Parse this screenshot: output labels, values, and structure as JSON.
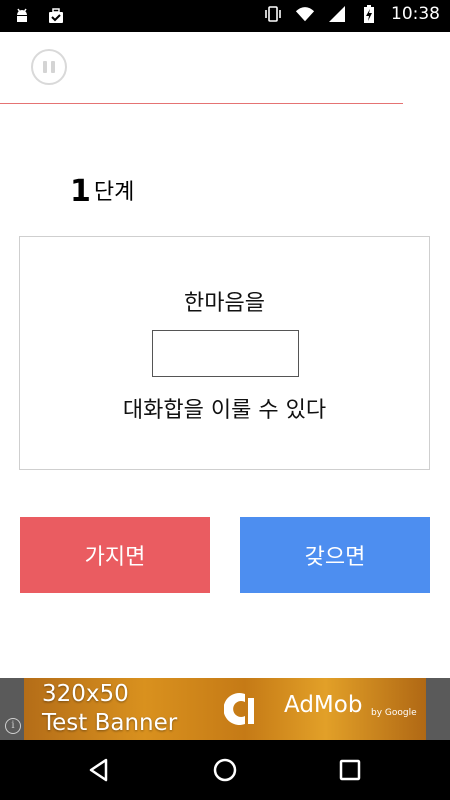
{
  "status_bar": {
    "time": "10:38",
    "left_icons": [
      "android-icon",
      "briefcase-check-icon"
    ],
    "right_icons": [
      "vibrate-icon",
      "wifi-icon",
      "signal-icon",
      "battery-charging-icon"
    ]
  },
  "top": {
    "pause_icon": "pause-icon",
    "progress_color": "#e57373"
  },
  "step": {
    "number": "1",
    "label": "단계"
  },
  "question": {
    "line1": "한마음을",
    "blank_value": "",
    "line2": "대화합을 이룰 수 있다"
  },
  "answers": {
    "left": {
      "label": "가지면",
      "color": "#ea5c61"
    },
    "right": {
      "label": "갖으면",
      "color": "#4d8ef0"
    }
  },
  "ad": {
    "line1": "320x50",
    "line2": "Test Banner",
    "brand": "AdMob",
    "by": "by Google",
    "info": "i"
  },
  "nav": {
    "icons": [
      "back-icon",
      "home-icon",
      "recents-icon"
    ]
  }
}
